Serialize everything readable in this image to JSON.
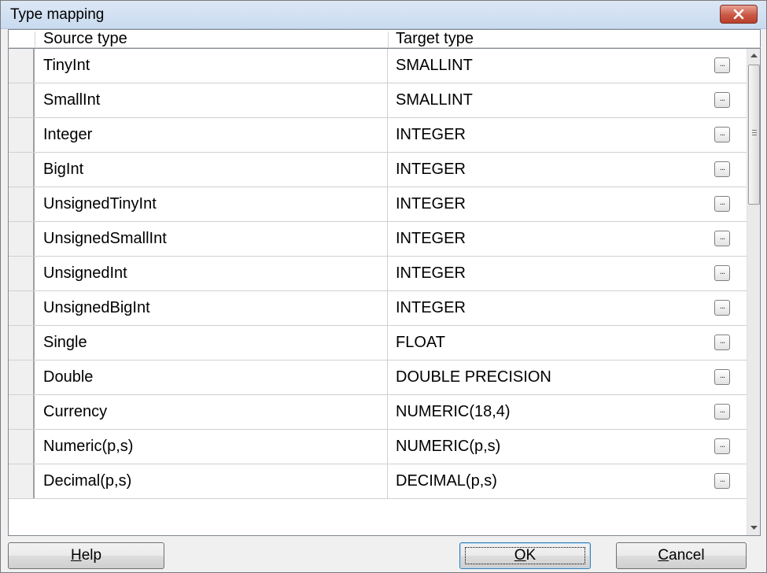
{
  "window": {
    "title": "Type mapping"
  },
  "grid": {
    "columns": [
      "Source type",
      "Target type"
    ],
    "rows": [
      {
        "source": "TinyInt",
        "target": "SMALLINT"
      },
      {
        "source": "SmallInt",
        "target": "SMALLINT"
      },
      {
        "source": "Integer",
        "target": "INTEGER"
      },
      {
        "source": "BigInt",
        "target": "INTEGER"
      },
      {
        "source": "UnsignedTinyInt",
        "target": "INTEGER"
      },
      {
        "source": "UnsignedSmallInt",
        "target": "INTEGER"
      },
      {
        "source": "UnsignedInt",
        "target": "INTEGER"
      },
      {
        "source": "UnsignedBigInt",
        "target": "INTEGER"
      },
      {
        "source": "Single",
        "target": "FLOAT"
      },
      {
        "source": "Double",
        "target": "DOUBLE PRECISION"
      },
      {
        "source": "Currency",
        "target": "NUMERIC(18,4)"
      },
      {
        "source": "Numeric(p,s)",
        "target": "NUMERIC(p,s)"
      },
      {
        "source": "Decimal(p,s)",
        "target": "DECIMAL(p,s)"
      }
    ],
    "ellipsis_label": "...",
    "ellipsis_icon": "ellipsis-icon"
  },
  "footer": {
    "help": {
      "label_first": "H",
      "label_rest": "elp"
    },
    "ok": {
      "label_first": "O",
      "label_rest": "K"
    },
    "cancel": {
      "label_first": "C",
      "label_rest": "ancel"
    }
  },
  "colors": {
    "close_button": "#c85845",
    "title_bar": "#dce7f5"
  }
}
